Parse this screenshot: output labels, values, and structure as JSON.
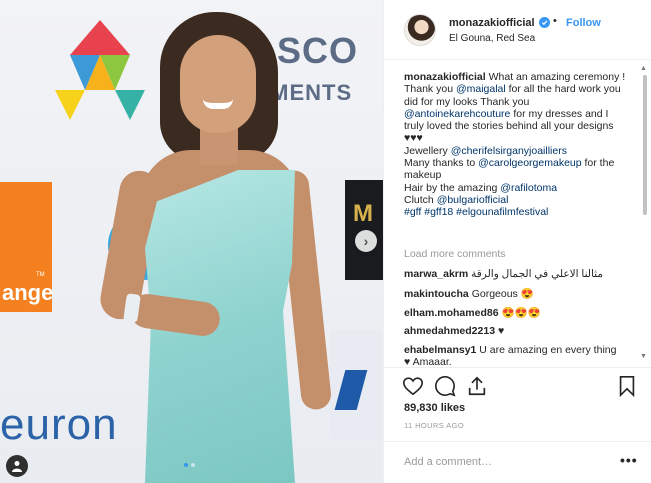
{
  "header": {
    "username": "monazakiofficial",
    "separator": "•",
    "follow_label": "Follow",
    "location": "El Gouna, Red Sea"
  },
  "photo": {
    "bg_text_a": "ASCO",
    "bg_text_b": "TSMENTS",
    "bg_text_c": "euron",
    "orange_text": "ange",
    "orange_tm": "TM",
    "dark_text": "M"
  },
  "caption": {
    "username": "monazakiofficial",
    "parts": [
      " What an amazing ceremony ! Thank you ",
      "@maigalal",
      " for all the hard work you did for my looks Thank you ",
      "@antoinekarehcouture",
      " for my dresses and I truly loved the stories behind all your designs ♥♥♥",
      "Jewellery ",
      "@cherifelsirganyjoailliers",
      "Many thanks to ",
      "@carolgeorgemakeup",
      " for the makeup",
      "Hair by the amazing ",
      "@rafilotoma",
      "Clutch ",
      "@bulgariofficial",
      "#gff #gff18 #elgounafilmfestival"
    ]
  },
  "load_more": "Load more comments",
  "comments": [
    {
      "user": "marwa_akrm",
      "text": "مثالنا الاعلي في الجمال والرقة"
    },
    {
      "user": "makintoucha",
      "text": "Gorgeous 😍"
    },
    {
      "user": "elham.mohamed86",
      "text": "😍😍😍"
    },
    {
      "user": "ahmedahmed2213",
      "text": "♥"
    },
    {
      "user": "ehabelmansy1",
      "text": "U are amazing en every thing ♥ Amaaar."
    }
  ],
  "likes": "89,830 likes",
  "time": "11 HOURS AGO",
  "add_comment_placeholder": "Add a comment…",
  "more_label": "•••",
  "colors": {
    "accent": "#3897f0",
    "mention": "#003569",
    "dress": "#8fd3cf"
  }
}
